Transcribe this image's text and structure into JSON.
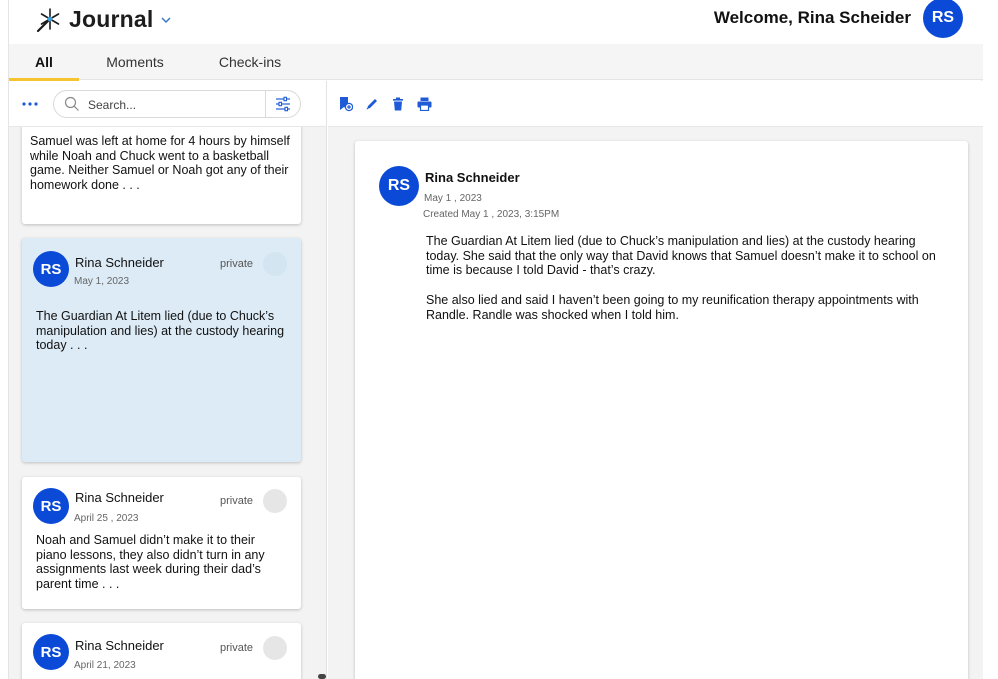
{
  "app": {
    "name": "Journal",
    "welcome": "Welcome, Rina Scheider",
    "user_initials": "RS",
    "brand_color": "#0a4ad6",
    "accent_color": "#f6c431"
  },
  "tabs": [
    {
      "label": "All",
      "active": true
    },
    {
      "label": "Moments",
      "active": false
    },
    {
      "label": "Check-ins",
      "active": false
    }
  ],
  "search": {
    "placeholder": "Search..."
  },
  "list": [
    {
      "excerpt": "Samuel was left at home for 4 hours by himself while Noah and Chuck went to a basketball game. Neither Samuel or Noah got any of their homework done . . ."
    },
    {
      "initials": "RS",
      "name": "Rina Schneider",
      "date": "May 1, 2023",
      "privacy": "private",
      "excerpt": "The Guardian At Litem lied (due to Chuck’s manipulation and lies) at the custody hearing today . . .",
      "selected": true
    },
    {
      "initials": "RS",
      "name": "Rina Schneider",
      "date": "April 25 , 2023",
      "privacy": "private",
      "excerpt": "Noah and Samuel didn’t make it to their piano lessons, they also didn’t turn in any assignments last week during their dad’s parent time . . ."
    },
    {
      "initials": "RS",
      "name": "Rina Schneider",
      "date": "April 21, 2023",
      "privacy": "private"
    }
  ],
  "detail": {
    "initials": "RS",
    "name": "Rina Schneider",
    "date": "May 1 , 2023",
    "created": "Created May 1 , 2023, 3:15PM",
    "paragraphs": [
      "The Guardian At Litem lied (due to Chuck’s manipulation and lies) at the custody hearing today. She said that the only way that David knows that Samuel doesn’t make it to school on time is because I told David - that’s crazy.",
      "She also lied and said I haven’t been going to my reunification therapy appointments with Randle. Randle was shocked when I told him."
    ]
  },
  "icons": {
    "logo": "journal-logo-icon",
    "more": "more-dots-icon",
    "search": "search-icon",
    "filter": "sliders-icon",
    "toolbar": [
      "add-entry-icon",
      "edit-pencil-icon",
      "trash-icon",
      "print-icon"
    ]
  }
}
